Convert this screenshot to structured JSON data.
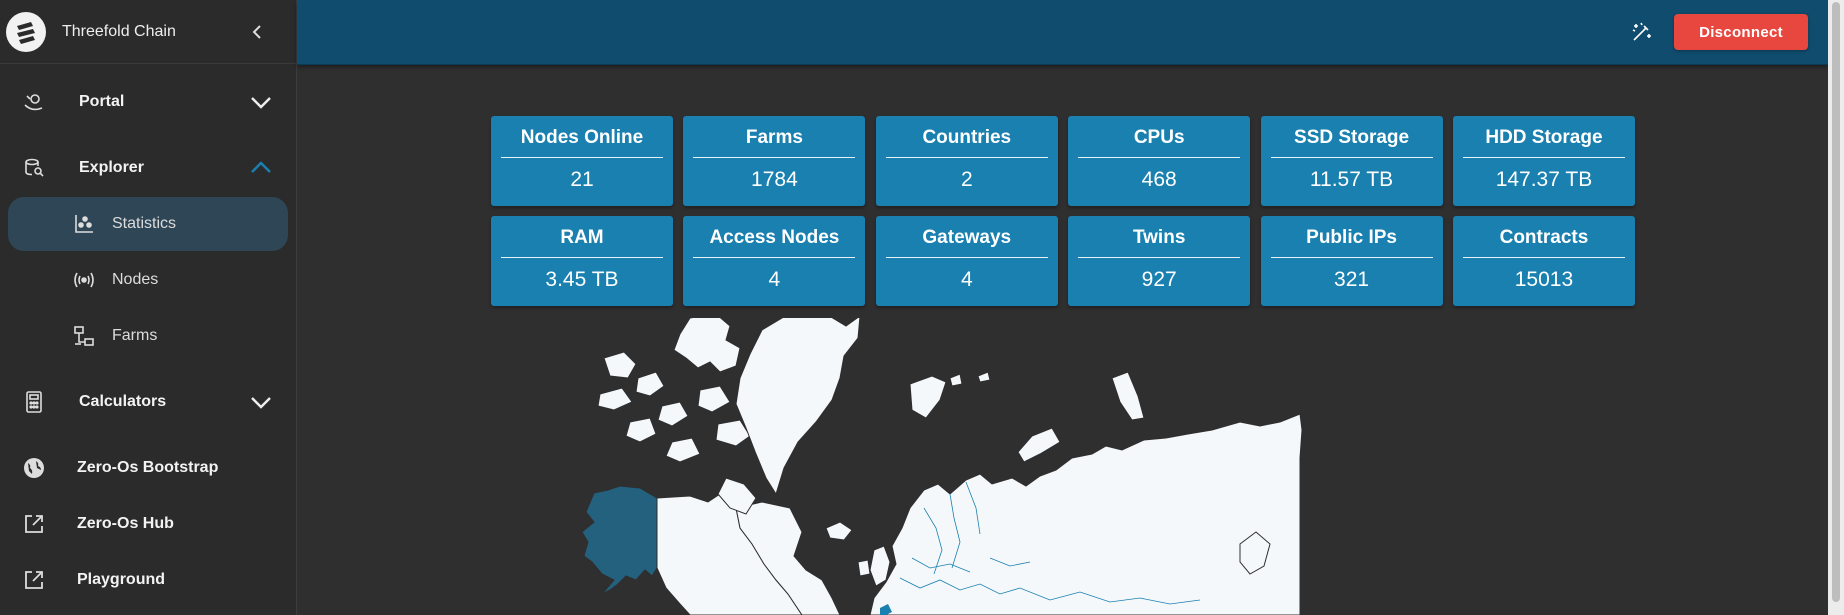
{
  "app": {
    "title": "Threefold Chain"
  },
  "sidebar": {
    "items": [
      {
        "label": "Portal",
        "icon": "portal-icon",
        "expanded": false
      },
      {
        "label": "Explorer",
        "icon": "explorer-icon",
        "expanded": true
      },
      {
        "label": "Calculators",
        "icon": "calculator-icon",
        "expanded": false
      },
      {
        "label": "Zero-Os Bootstrap",
        "icon": "globe-icon"
      },
      {
        "label": "Zero-Os Hub",
        "icon": "external-link-icon"
      },
      {
        "label": "Playground",
        "icon": "external-link-icon"
      }
    ],
    "explorer_sub": [
      {
        "label": "Statistics",
        "icon": "statistics-icon",
        "active": true
      },
      {
        "label": "Nodes",
        "icon": "nodes-icon",
        "active": false
      },
      {
        "label": "Farms",
        "icon": "farms-icon",
        "active": false
      }
    ]
  },
  "topbar": {
    "disconnect_label": "Disconnect"
  },
  "stats": [
    {
      "title": "Nodes Online",
      "value": "21"
    },
    {
      "title": "Farms",
      "value": "1784"
    },
    {
      "title": "Countries",
      "value": "2"
    },
    {
      "title": "CPUs",
      "value": "468"
    },
    {
      "title": "SSD Storage",
      "value": "11.57 TB"
    },
    {
      "title": "HDD Storage",
      "value": "147.37 TB"
    },
    {
      "title": "RAM",
      "value": "3.45 TB"
    },
    {
      "title": "Access Nodes",
      "value": "4"
    },
    {
      "title": "Gateways",
      "value": "4"
    },
    {
      "title": "Twins",
      "value": "927"
    },
    {
      "title": "Public IPs",
      "value": "321"
    },
    {
      "title": "Contracts",
      "value": "15013"
    }
  ],
  "colors": {
    "accent": "#1a80b0",
    "topbar": "#0f4c6d",
    "danger": "#e8473f",
    "active_bg": "#2f4656",
    "map_land": "#f4f8fb",
    "map_highlight": "#23617e"
  }
}
